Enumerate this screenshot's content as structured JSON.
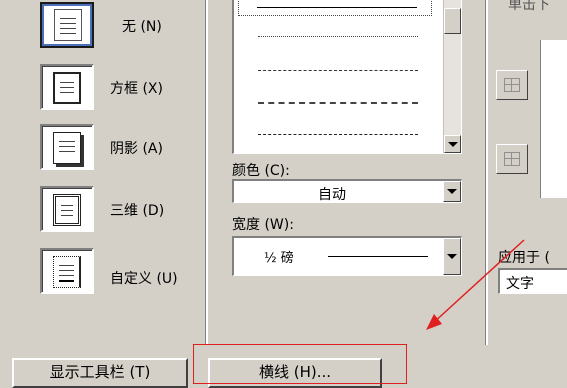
{
  "dialog": {
    "settings": [
      {
        "label": "无 (N)"
      },
      {
        "label": "方框 (X)"
      },
      {
        "label": "阴影 (A)"
      },
      {
        "label": "三维 (D)"
      },
      {
        "label": "自定义 (U)"
      }
    ],
    "color": {
      "label": "颜色 (C):",
      "value": "自动"
    },
    "width": {
      "label": "宽度 (W):",
      "value": "½ 磅"
    },
    "apply_to": {
      "label": "应用于 (",
      "value": "文字"
    },
    "preview_label": "单击下"
  },
  "buttons": {
    "show_toolbar": "显示工具栏 (T)",
    "horizontal_line": "横线 (H)..."
  },
  "annotation": {
    "color": "#e02020"
  }
}
